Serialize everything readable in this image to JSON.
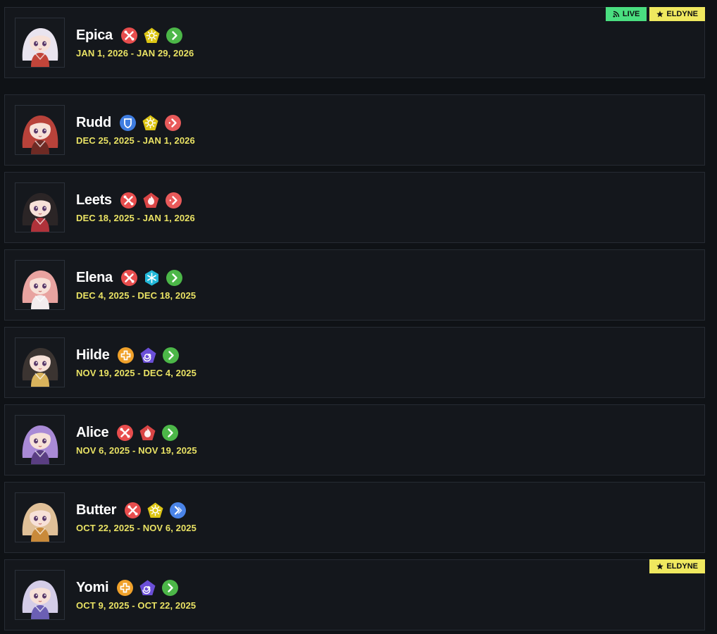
{
  "badges": {
    "live": "LIVE",
    "eldyne": "ELDYNE"
  },
  "colors": {
    "background": "#0f1216",
    "card": "#14171c",
    "border": "#262b33",
    "name": "#ffffff",
    "dates": "#e9e264",
    "badge_live": "#4ade80",
    "badge_eldyne": "#efe85f",
    "class_striker": "#e84d4d",
    "class_defender": "#3f7de0",
    "class_healer": "#f0a12a",
    "element_light": "#dcc514",
    "element_fire": "#d94545",
    "element_ice": "#22b8d9",
    "element_dark": "#6b4fd8",
    "position_front": "#4cb748",
    "position_back_red": "#e85a5a",
    "position_back_blue": "#4a84e8"
  },
  "characters": [
    {
      "name": "Epica",
      "dates": "JAN 1, 2026 - JAN 29, 2026",
      "icons": [
        "class-striker-icon",
        "element-light-icon",
        "position-front-icon"
      ],
      "badges": [
        "LIVE",
        "ELDYNE"
      ],
      "hair_color": "#e9e4ef",
      "accent_color": "#c2453a"
    },
    {
      "name": "Rudd",
      "dates": "DEC 25, 2025 - JAN 1, 2026",
      "icons": [
        "class-defender-icon",
        "element-light-icon",
        "position-back-red-icon"
      ],
      "badges": [],
      "hair_color": "#b8423a",
      "accent_color": "#6e2a24"
    },
    {
      "name": "Leets",
      "dates": "DEC 18, 2025 - JAN 1, 2026",
      "icons": [
        "class-striker-icon",
        "element-fire-icon",
        "position-back-red-icon"
      ],
      "badges": [],
      "hair_color": "#2b2526",
      "accent_color": "#b0323a"
    },
    {
      "name": "Elena",
      "dates": "DEC 4, 2025 - DEC 18, 2025",
      "icons": [
        "class-striker-icon",
        "element-ice-icon",
        "position-front-icon"
      ],
      "badges": [],
      "hair_color": "#e8a3a0",
      "accent_color": "#f3ecee"
    },
    {
      "name": "Hilde",
      "dates": "NOV 19, 2025 - DEC 4, 2025",
      "icons": [
        "class-healer-icon",
        "element-dark-icon",
        "position-front-icon"
      ],
      "badges": [],
      "hair_color": "#3b3431",
      "accent_color": "#d9b35c"
    },
    {
      "name": "Alice",
      "dates": "NOV 6, 2025 - NOV 19, 2025",
      "icons": [
        "class-striker-icon",
        "element-fire-icon",
        "position-front-icon"
      ],
      "badges": [],
      "hair_color": "#a98ad6",
      "accent_color": "#5a3e82"
    },
    {
      "name": "Butter",
      "dates": "OCT 22, 2025 - NOV 6, 2025",
      "icons": [
        "class-striker-icon",
        "element-light-icon",
        "position-back-blue-icon"
      ],
      "badges": [],
      "hair_color": "#e0c098",
      "accent_color": "#c98a3a"
    },
    {
      "name": "Yomi",
      "dates": "OCT 9, 2025 - OCT 22, 2025",
      "icons": [
        "class-healer-icon",
        "element-dark-icon",
        "position-front-icon"
      ],
      "badges": [
        "ELDYNE"
      ],
      "hair_color": "#d4cde8",
      "accent_color": "#6b5fb4"
    }
  ]
}
